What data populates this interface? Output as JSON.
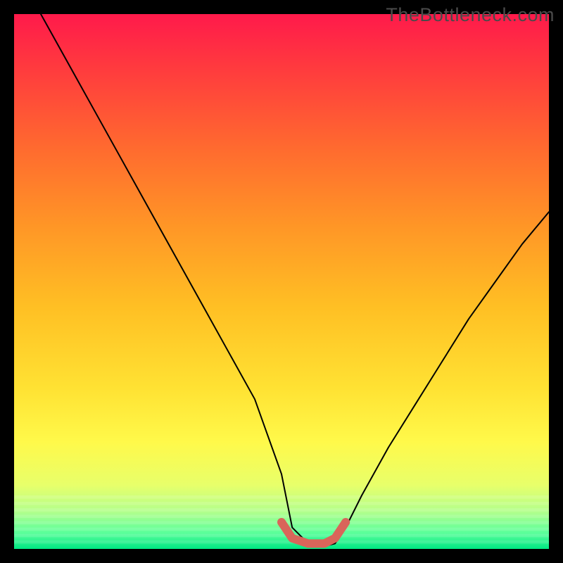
{
  "watermark": "TheBottleneck.com",
  "chart_data": {
    "type": "line",
    "title": "",
    "xlabel": "",
    "ylabel": "",
    "xlim": [
      0,
      100
    ],
    "ylim": [
      0,
      100
    ],
    "grid": false,
    "legend": false,
    "background_gradient": {
      "stops": [
        {
          "offset": 0.0,
          "color": "#ff1a4b"
        },
        {
          "offset": 0.1,
          "color": "#ff3a3e"
        },
        {
          "offset": 0.25,
          "color": "#ff6a2f"
        },
        {
          "offset": 0.4,
          "color": "#ff9726"
        },
        {
          "offset": 0.55,
          "color": "#ffc024"
        },
        {
          "offset": 0.7,
          "color": "#ffe233"
        },
        {
          "offset": 0.8,
          "color": "#fff94a"
        },
        {
          "offset": 0.88,
          "color": "#e8ff6a"
        },
        {
          "offset": 0.93,
          "color": "#b3ff8c"
        },
        {
          "offset": 0.97,
          "color": "#5aff9a"
        },
        {
          "offset": 1.0,
          "color": "#00e884"
        }
      ]
    },
    "series": [
      {
        "name": "bottleneck-curve",
        "comment": "V-shaped bottleneck curve; y is mismatch percentage (100 top, 0 bottom). Minimum plateau near x≈52–62.",
        "x": [
          5,
          10,
          15,
          20,
          25,
          30,
          35,
          40,
          45,
          50,
          52,
          55,
          58,
          60,
          62,
          65,
          70,
          75,
          80,
          85,
          90,
          95,
          100
        ],
        "y": [
          100,
          91,
          82,
          73,
          64,
          55,
          46,
          37,
          28,
          14,
          4,
          1,
          0.5,
          1,
          4,
          10,
          19,
          27,
          35,
          43,
          50,
          57,
          63
        ]
      },
      {
        "name": "optimal-zone-marker",
        "comment": "Thick salmon segment at the trough indicating optimal match region.",
        "x": [
          50,
          52,
          55,
          58,
          60,
          62
        ],
        "y": [
          5,
          2,
          1,
          1,
          2,
          5
        ]
      }
    ],
    "colors": {
      "curve": "#000000",
      "marker": "#d9655a"
    }
  }
}
